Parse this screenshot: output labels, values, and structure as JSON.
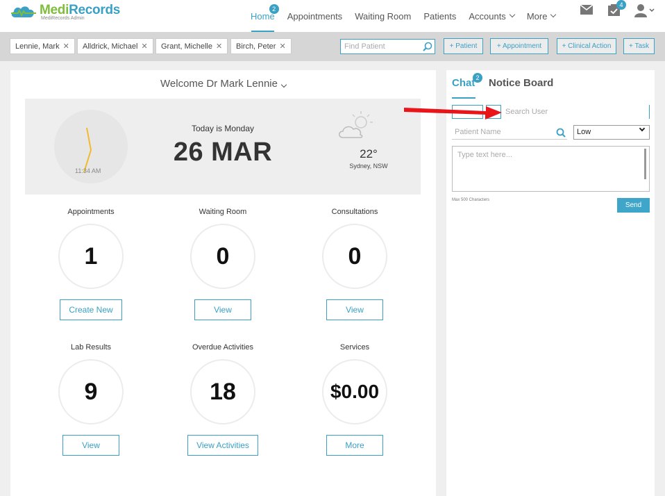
{
  "brand": {
    "name_part1": "Medi",
    "name_part2": "Records",
    "subtitle": "MediRecords Admin"
  },
  "nav": {
    "home": "Home",
    "home_badge": "2",
    "appointments": "Appointments",
    "waiting_room": "Waiting Room",
    "patients": "Patients",
    "accounts": "Accounts",
    "more": "More",
    "tasks_badge": "4"
  },
  "patient_tabs": [
    "Lennie, Mark",
    "Alldrick, Michael",
    "Grant, Michelle",
    "Birch, Peter"
  ],
  "find_patient": {
    "placeholder": "Find Patient"
  },
  "actions": {
    "patient": "+ Patient",
    "appointment": "+ Appointment",
    "clinical_action": "+ Clinical Action",
    "task": "+ Task"
  },
  "dashboard": {
    "welcome": "Welcome Dr Mark Lennie",
    "clock_time": "11:34 AM",
    "today_label": "Today is Monday",
    "date": "26 MAR",
    "temperature": "22°",
    "location": "Sydney, NSW"
  },
  "stats": [
    {
      "label": "Appointments",
      "value": "1",
      "button": "Create New"
    },
    {
      "label": "Waiting Room",
      "value": "0",
      "button": "View"
    },
    {
      "label": "Consultations",
      "value": "0",
      "button": "View"
    },
    {
      "label": "Lab Results",
      "value": "9",
      "button": "View"
    },
    {
      "label": "Overdue Activities",
      "value": "18",
      "button": "View Activities"
    },
    {
      "label": "Services",
      "value": "$0.00",
      "button": "More"
    }
  ],
  "side": {
    "chat_tab": "Chat",
    "chat_badge": "2",
    "notice_tab": "Notice Board",
    "search_user_placeholder": "Search User",
    "patient_name_placeholder": "Patient Name",
    "priority_value": "Low",
    "message_placeholder": "Type text here...",
    "max_chars": "Max 500 Characters",
    "send": "Send"
  },
  "colors": {
    "accent": "#3aa0c4",
    "brand_green": "#7fbd3c",
    "annotation_arrow": "#e8161b",
    "clock_hand": "#f2b92a"
  }
}
